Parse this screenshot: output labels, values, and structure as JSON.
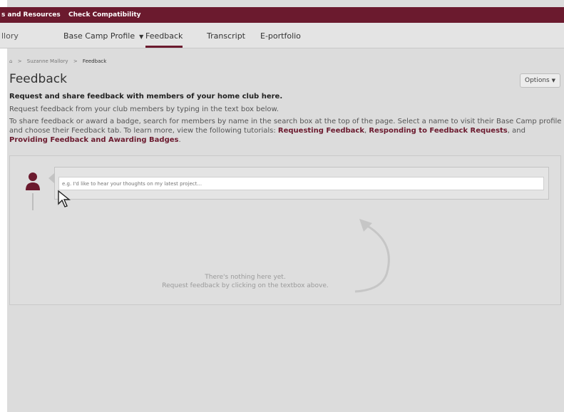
{
  "topbar": {
    "links": [
      "s and Resources",
      "Check Compatibility"
    ]
  },
  "tabs": {
    "partial": "llory",
    "items": [
      "Base Camp Profile",
      "Feedback",
      "Transcript",
      "E-portfolio"
    ],
    "active": "Feedback"
  },
  "breadcrumb": {
    "home_icon": "home-icon",
    "separator": ">",
    "user": "Suzanne Mallory",
    "current": "Feedback"
  },
  "page": {
    "title": "Feedback",
    "options_label": "Options"
  },
  "intro": {
    "bold": "Request and share feedback with members of your home club here.",
    "line2": "Request feedback from your club members by typing in the text box below.",
    "para_start": "To share feedback or award a badge, search for members by name in the search box at the top of the page. Select a name to visit their Base Camp profile and choose their Feedback tab. To learn more, view the following tutorials: ",
    "link1": "Requesting Feedback",
    "sep1": ", ",
    "link2": "Responding to Feedback Requests",
    "sep2": ", and ",
    "link3": "Providing Feedback and Awarding Badges",
    "end": "."
  },
  "composer": {
    "placeholder": "e.g. I'd like to hear your thoughts on my latest project..."
  },
  "empty_state": {
    "line1": "There's nothing here yet.",
    "line2": "Request feedback by clicking on the textbox above."
  },
  "colors": {
    "brand": "#6b1a2e",
    "link": "#6b1a2e"
  }
}
